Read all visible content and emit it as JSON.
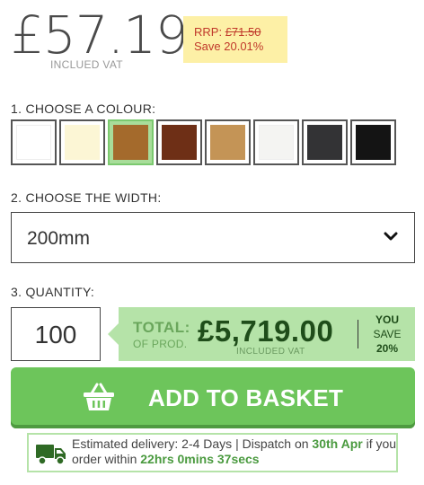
{
  "price": {
    "amount": "£57.19",
    "vat_note": "INCLUED VAT",
    "rrp_label": "RRP:",
    "rrp_value": "£71.50",
    "save_text": "Save 20.01%"
  },
  "colour_section": {
    "label": "1. CHOOSE A COLOUR:",
    "swatches": [
      {
        "name": "white",
        "color": "#ffffff",
        "selected": false
      },
      {
        "name": "cream",
        "color": "#fcf6d5",
        "selected": false
      },
      {
        "name": "golden-oak",
        "color": "#a46a2c",
        "selected": true
      },
      {
        "name": "rosewood",
        "color": "#6e2f16",
        "selected": false
      },
      {
        "name": "light-oak",
        "color": "#c49456",
        "selected": false
      },
      {
        "name": "white-ash",
        "color": "#f4f4f2",
        "selected": false
      },
      {
        "name": "anthracite-grey",
        "color": "#333335",
        "selected": false
      },
      {
        "name": "black-ash",
        "color": "#141414",
        "selected": false
      }
    ]
  },
  "width_section": {
    "label": "2. CHOOSE THE WIDTH:",
    "selected": "200mm"
  },
  "quantity_section": {
    "label": "3. QUANTITY:",
    "value": "100"
  },
  "total": {
    "label": "TOTAL:",
    "sub_label": "OF PROD.",
    "amount": "£5,719.00",
    "vat_note": "INCLUDED VAT",
    "save_line1": "YOU",
    "save_line2": "SAVE",
    "save_line3": "20%"
  },
  "basket_button": {
    "label": "ADD TO BASKET"
  },
  "delivery": {
    "part1": "Estimated delivery: 2-4 Days | Dispatch on ",
    "date": "30th Apr",
    "part2": " if you order within ",
    "countdown": "22hrs 0mins 37secs"
  },
  "colors": {
    "accent_green": "#6dc55b",
    "panel_green": "#b5e3a8",
    "dark_green": "#1f4d1a",
    "rrp_bg": "#fdf0a6",
    "rrp_red": "#c0392b"
  },
  "icons": {
    "basket": "basket-icon",
    "truck": "truck-icon",
    "chevron": "chevron-down-icon"
  }
}
